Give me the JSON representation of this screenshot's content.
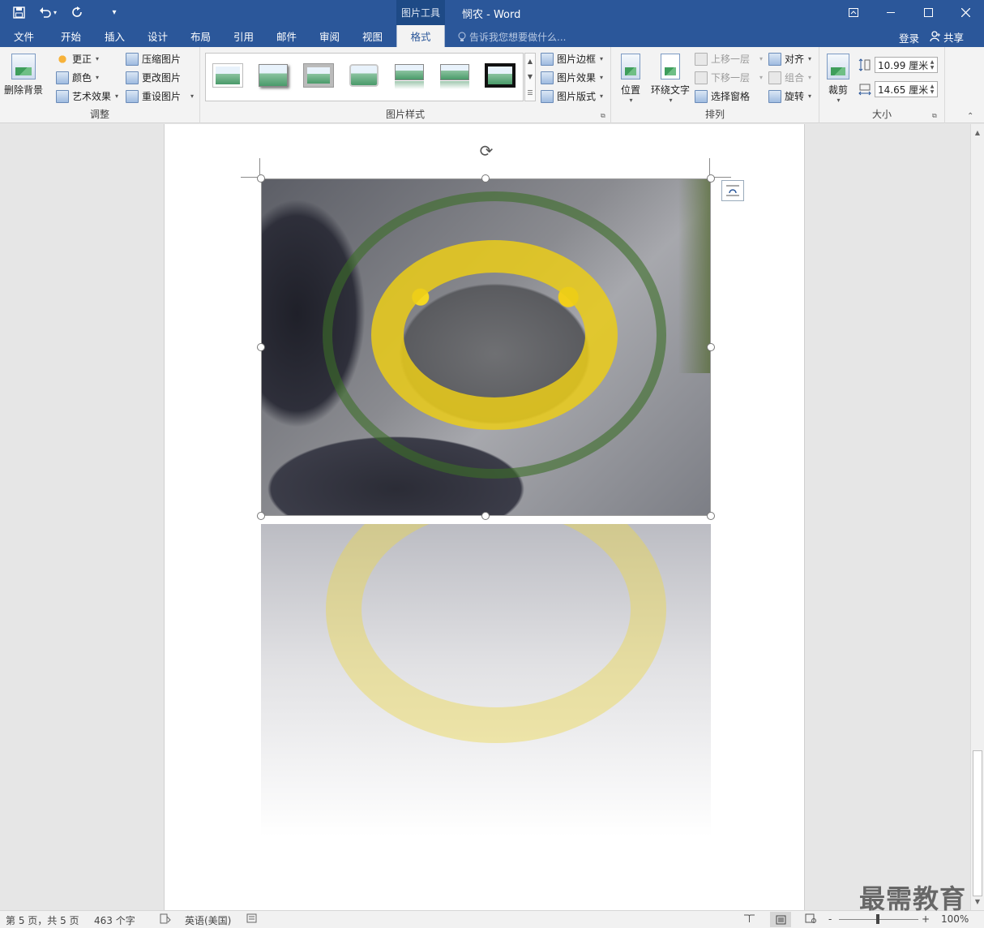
{
  "titlebar": {
    "context_tab": "图片工具",
    "title": "悯农 - Word",
    "qat_customize": "▾"
  },
  "tabs": [
    {
      "label": "文件",
      "active": false
    },
    {
      "label": "开始",
      "active": false
    },
    {
      "label": "插入",
      "active": false
    },
    {
      "label": "设计",
      "active": false
    },
    {
      "label": "布局",
      "active": false
    },
    {
      "label": "引用",
      "active": false
    },
    {
      "label": "邮件",
      "active": false
    },
    {
      "label": "审阅",
      "active": false
    },
    {
      "label": "视图",
      "active": false
    },
    {
      "label": "格式",
      "active": true
    }
  ],
  "tell_me": {
    "placeholder": "告诉我您想要做什么..."
  },
  "account": {
    "signin": "登录",
    "share": "共享"
  },
  "ribbon": {
    "adjust": {
      "label": "调整",
      "remove_bg": "删除背景",
      "corrections": "更正",
      "color": "颜色",
      "artistic": "艺术效果",
      "compress": "压缩图片",
      "change": "更改图片",
      "reset": "重设图片"
    },
    "styles": {
      "label": "图片样式",
      "border": "图片边框",
      "effects": "图片效果",
      "layout": "图片版式"
    },
    "arrange": {
      "label": "排列",
      "position": "位置",
      "wrap": "环绕文字",
      "forward": "上移一层",
      "backward": "下移一层",
      "selection_pane": "选择窗格",
      "align": "对齐",
      "group": "组合",
      "rotate": "旋转"
    },
    "size": {
      "label": "大小",
      "crop": "裁剪",
      "height": "10.99 厘米",
      "width": "14.65 厘米"
    }
  },
  "status": {
    "page": "第 5 页，共 5 页",
    "words": "463 个字",
    "language": "英语(美国)",
    "zoom": "100%",
    "zoom_minus": "-",
    "zoom_plus": "+"
  },
  "watermark": "最需教育",
  "colors": {
    "accent": "#2b579a",
    "ribbon_bg": "#f3f3f3",
    "canvas_bg": "#e6e6e6"
  }
}
